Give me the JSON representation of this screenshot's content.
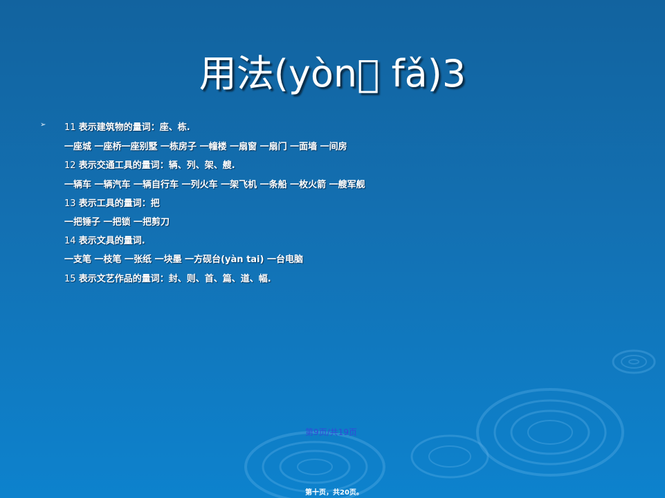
{
  "slide": {
    "title": "用法(yòn\u0000 fǎ)3",
    "bullet_glyph": "➢",
    "lines": [
      {
        "num": "11 ",
        "text": "表示建筑物的量词：座、栋."
      },
      {
        "num": "",
        "text": "一座城 一座桥一座别墅 一栋房子 一幢楼  一扇窗 一扇门 一面墙  一间房"
      },
      {
        "num": "12 ",
        "text": "表示交通工具的量词：辆、列、架、艘."
      },
      {
        "num": "",
        "text": "一辆车 一辆汽车 一辆自行车 一列火车 一架飞机 一条船 一枚火箭 一艘军舰"
      },
      {
        "num": "13 ",
        "text": "表示工具的量词：把"
      },
      {
        "num": "",
        "text": "一把锤子 一把锁 一把剪刀"
      },
      {
        "num": "14 ",
        "text": "表示文具的量词."
      },
      {
        "num": "",
        "text": "一支笔 一枝笔 一张纸 一块墨 一方砚台(yàn tai) 一台电脑"
      },
      {
        "num": "15 ",
        "text": "表示文艺作品的量词：封、则、首、篇、道、幅."
      }
    ],
    "pager": "第9页/共19页",
    "footer": "第十页，共20页。"
  },
  "colors": {
    "background_top": "#12639f",
    "background_bottom": "#0d82cd",
    "text": "#ffffff",
    "pager": "#3349d8"
  }
}
